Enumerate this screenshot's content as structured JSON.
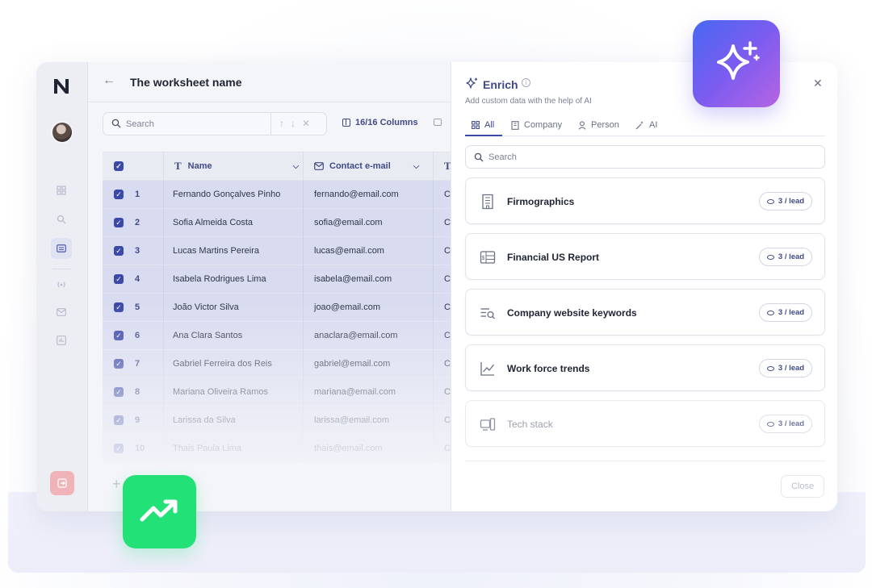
{
  "topbar": {
    "title": "The worksheet name"
  },
  "toolbar": {
    "search_placeholder": "Search",
    "columns_label": "16/16 Columns"
  },
  "table": {
    "headers": {
      "name": "Name",
      "email": "Contact e-mail"
    },
    "rows": [
      {
        "num": "1",
        "name": "Fernando Gonçalves Pinho",
        "email": "fernando@email.com",
        "extra": "C"
      },
      {
        "num": "2",
        "name": "Sofia Almeida Costa",
        "email": "sofia@email.com",
        "extra": "C"
      },
      {
        "num": "3",
        "name": "Lucas Martins Pereira",
        "email": "lucas@email.com",
        "extra": "C"
      },
      {
        "num": "4",
        "name": "Isabela Rodrigues Lima",
        "email": "isabela@email.com",
        "extra": "C"
      },
      {
        "num": "5",
        "name": "João Victor Silva",
        "email": "joao@email.com",
        "extra": "C"
      },
      {
        "num": "6",
        "name": "Ana Clara Santos",
        "email": "anaclara@email.com",
        "extra": "C"
      },
      {
        "num": "7",
        "name": "Gabriel Ferreira dos Reis",
        "email": "gabriel@email.com",
        "extra": "C"
      },
      {
        "num": "8",
        "name": "Mariana Oliveira Ramos",
        "email": "mariana@email.com",
        "extra": "C"
      },
      {
        "num": "9",
        "name": "Larissa da Silva",
        "email": "larissa@email.com",
        "extra": "C"
      },
      {
        "num": "10",
        "name": "Thais Paula Lima",
        "email": "thais@email.com",
        "extra": "C"
      }
    ]
  },
  "enrich": {
    "title": "Enrich",
    "subtitle": "Add custom data with the help of AI",
    "tabs": [
      {
        "label": "All",
        "icon": "grid-icon",
        "active": true
      },
      {
        "label": "Company",
        "icon": "building-icon",
        "active": false
      },
      {
        "label": "Person",
        "icon": "person-icon",
        "active": false
      },
      {
        "label": "AI",
        "icon": "sparkle-icon",
        "active": false
      }
    ],
    "search_placeholder": "Search",
    "cards": [
      {
        "label": "Firmographics",
        "icon": "building-icon",
        "cost": "3 / lead"
      },
      {
        "label": "Financial US Report",
        "icon": "report-icon",
        "cost": "3 / lead"
      },
      {
        "label": "Company website keywords",
        "icon": "keyword-search-icon",
        "cost": "3 / lead"
      },
      {
        "label": "Work force trends",
        "icon": "trend-chart-icon",
        "cost": "3 / lead"
      },
      {
        "label": "Tech stack",
        "icon": "devices-icon",
        "cost": "3 / lead"
      }
    ],
    "close_label": "Close"
  },
  "colors": {
    "accent": "#3b4aa8",
    "selected_row": "#d9dcf0",
    "spark_gradient": [
      "#4868f2",
      "#b764e3"
    ],
    "trend_green": "#22e277"
  }
}
